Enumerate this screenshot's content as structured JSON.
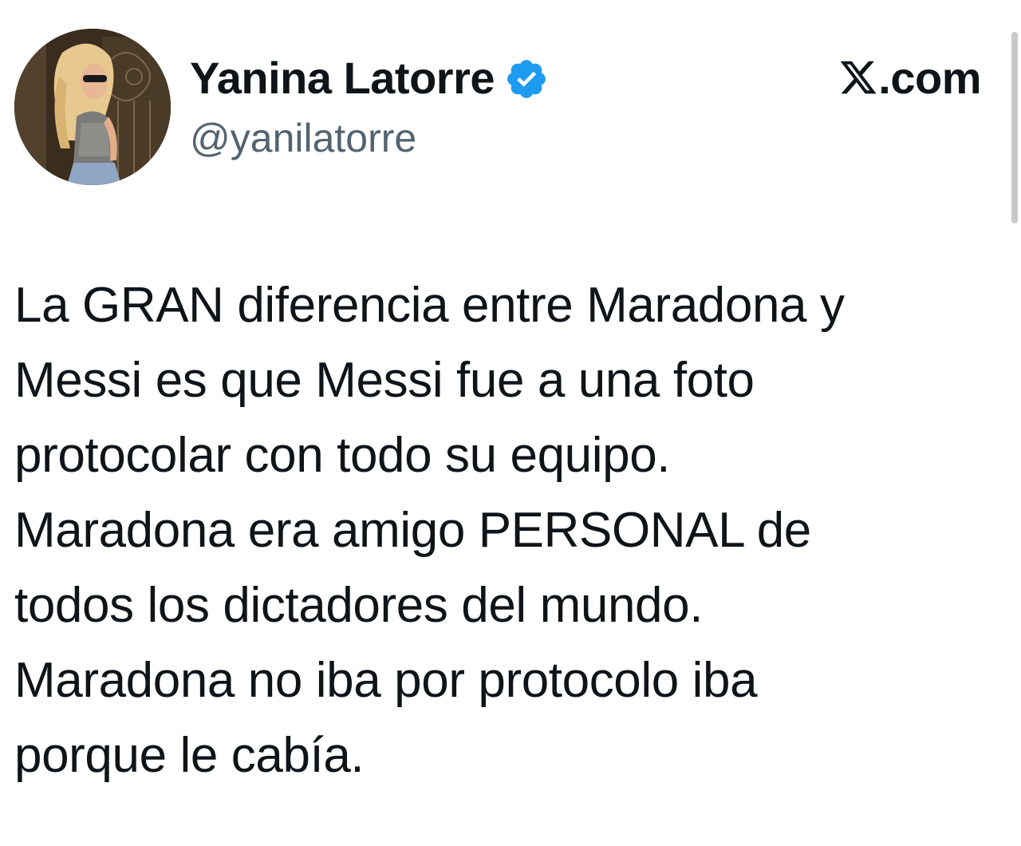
{
  "author": {
    "display_name": "Yanina Latorre",
    "handle": "@yanilatorre",
    "verified": true,
    "verified_color": "#1d9bf0",
    "avatar_icon": "profile-photo-avatar"
  },
  "brand": {
    "icon": "x-logo-icon",
    "text": ".com"
  },
  "tweet": {
    "lines": [
      "La GRAN diferencia entre Maradona y",
      "Messi es que Messi fue a una foto",
      "protocolar con todo su equipo.",
      "Maradona era amigo PERSONAL de",
      "todos los dictadores del mundo.",
      "Maradona no iba por protocolo iba",
      "porque le cabía."
    ]
  },
  "colors": {
    "text_primary": "#0f1419",
    "text_secondary": "#536471",
    "background": "#ffffff"
  }
}
